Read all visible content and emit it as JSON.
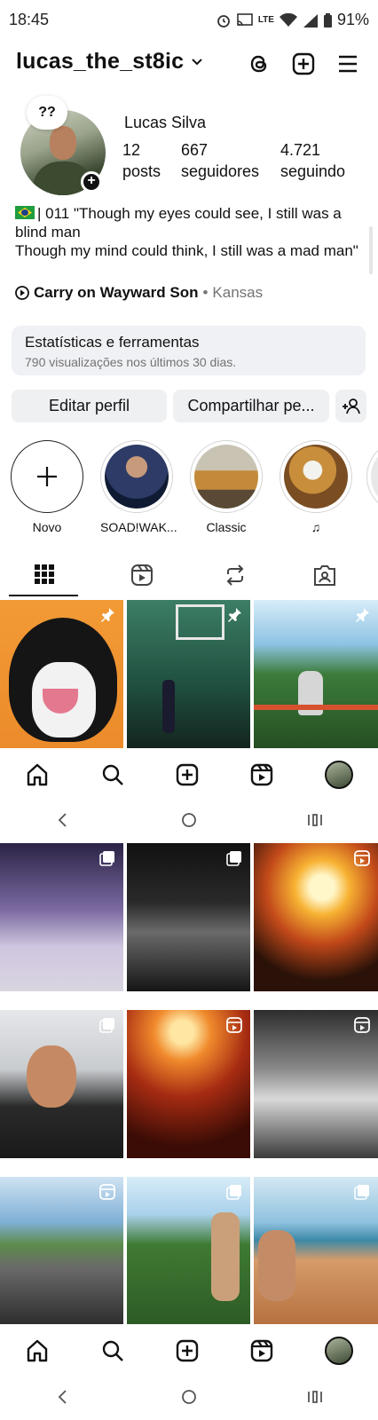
{
  "status": {
    "time": "18:45",
    "network": "LTE",
    "battery": "91%"
  },
  "header": {
    "username": "lucas_the_st8ic",
    "icons": [
      "chevron-down-icon",
      "threads-icon",
      "create-icon",
      "menu-icon"
    ]
  },
  "profile": {
    "note": "??",
    "full_name": "Lucas Silva",
    "stats": [
      {
        "value": "12",
        "label": "posts"
      },
      {
        "value": "667",
        "label": "seguidores"
      },
      {
        "value": "4.721",
        "label": "seguindo"
      }
    ],
    "bio_line1": "| 011 \"Though my eyes could see, I still was a blind man",
    "bio_line2": "Though my mind could think, I still was a mad man\"",
    "music_song": "Carry on Wayward Son",
    "music_sep": " • ",
    "music_artist": "Kansas"
  },
  "tools": {
    "title": "Estatísticas e ferramentas",
    "subtitle": "790 visualizações nos últimos 30 dias."
  },
  "buttons": {
    "edit": "Editar perfil",
    "share": "Compartilhar pe..."
  },
  "highlights": [
    {
      "label": "Novo"
    },
    {
      "label": "SOAD!WAK..."
    },
    {
      "label": "Classic"
    },
    {
      "label": "♫"
    }
  ],
  "tabs": [
    "grid-icon",
    "reels-icon",
    "reposts-icon",
    "tagged-icon"
  ],
  "bottom_nav": [
    "home-icon",
    "search-icon",
    "create-icon",
    "reels-icon",
    "profile-avatar"
  ],
  "colors": {
    "text": "#111111",
    "muted": "#737373",
    "button_bg": "#eff0f2",
    "panel_bg": "#f0f1f4"
  }
}
